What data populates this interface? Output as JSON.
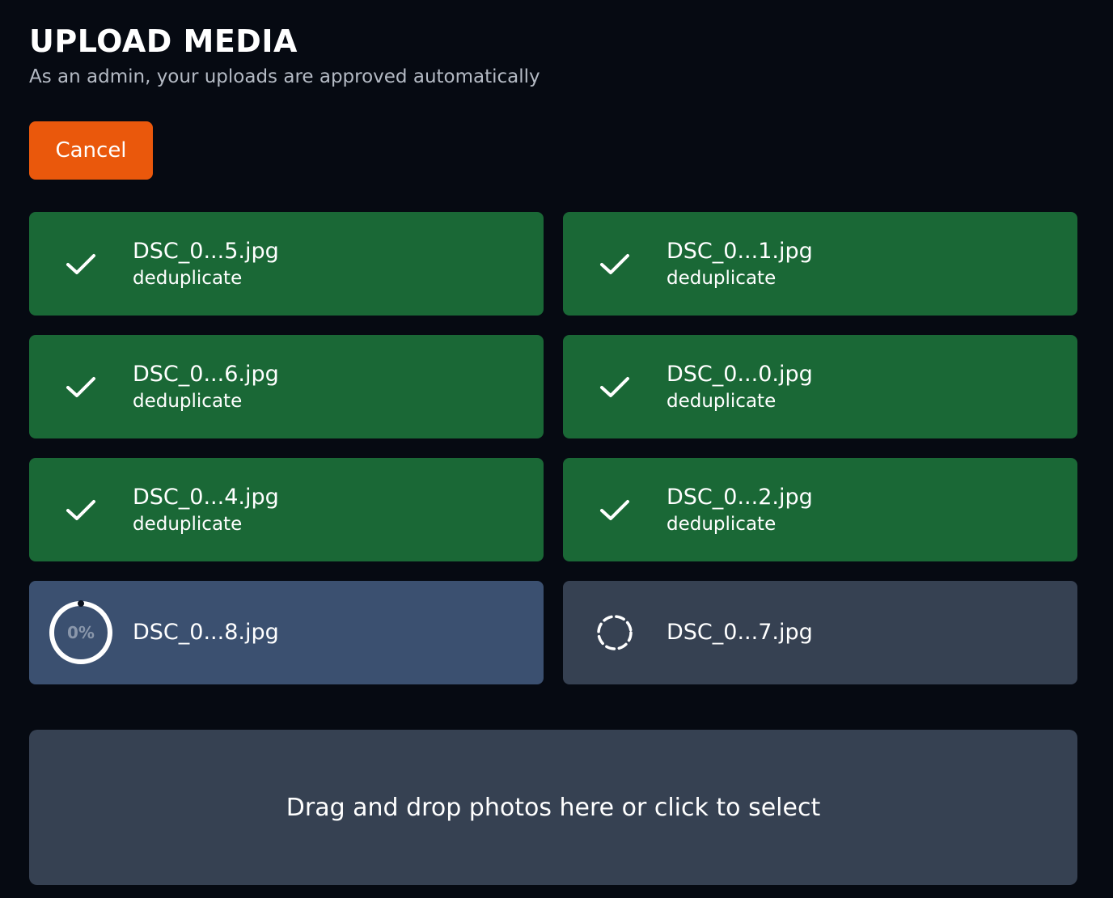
{
  "header": {
    "title": "UPLOAD MEDIA",
    "subtitle": "As an admin, your uploads are approved automatically"
  },
  "actions": {
    "cancel_label": "Cancel"
  },
  "uploads": [
    {
      "name": "DSC_0...5.jpg",
      "status": "deduplicate",
      "state": "done",
      "icon": "check-icon"
    },
    {
      "name": "DSC_0...1.jpg",
      "status": "deduplicate",
      "state": "done",
      "icon": "check-icon"
    },
    {
      "name": "DSC_0...6.jpg",
      "status": "deduplicate",
      "state": "done",
      "icon": "check-icon"
    },
    {
      "name": "DSC_0...0.jpg",
      "status": "deduplicate",
      "state": "done",
      "icon": "check-icon"
    },
    {
      "name": "DSC_0...4.jpg",
      "status": "deduplicate",
      "state": "done",
      "icon": "check-icon"
    },
    {
      "name": "DSC_0...2.jpg",
      "status": "deduplicate",
      "state": "done",
      "icon": "check-icon"
    },
    {
      "name": "DSC_0...8.jpg",
      "state": "uploading",
      "progress_label": "0%",
      "progress": 0,
      "icon": "progress-ring-icon"
    },
    {
      "name": "DSC_0...7.jpg",
      "state": "pending",
      "icon": "dashed-circle-icon"
    }
  ],
  "dropzone": {
    "label": "Drag and drop photos here or click to select"
  },
  "colors": {
    "background": "#060a12",
    "accent": "#ea580c",
    "done": "#1a6836",
    "uploading": "#3b5070",
    "pending": "#364152"
  }
}
